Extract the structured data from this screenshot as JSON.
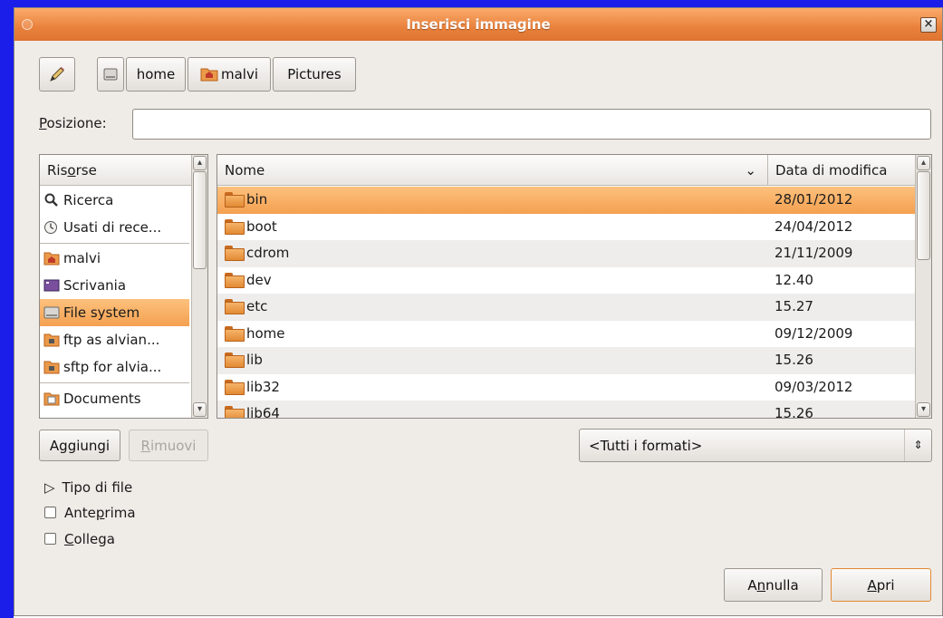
{
  "window": {
    "title": "Inserisci immagine",
    "close_glyph": "×"
  },
  "toolbar": {
    "edit_icon": "pencil-icon",
    "path": [
      {
        "label": "",
        "icon": "harddisk-icon"
      },
      {
        "label": "home",
        "icon": ""
      },
      {
        "label": "malvi",
        "icon": "home-folder-icon"
      },
      {
        "label": "Pictures",
        "icon": ""
      }
    ]
  },
  "location": {
    "label_underline": "P",
    "label_rest": "osizione:",
    "value": ""
  },
  "places": {
    "header_a": "Ris",
    "header_u": "o",
    "header_b": "rse",
    "items": [
      {
        "label": "Ricerca",
        "icon": "search-icon"
      },
      {
        "label": "Usati di rece...",
        "icon": "recent-icon"
      },
      {
        "label": "malvi",
        "icon": "home-folder-icon"
      },
      {
        "label": "Scrivania",
        "icon": "desktop-icon"
      },
      {
        "label": "File system",
        "icon": "harddisk-icon"
      },
      {
        "label": "ftp as alvian...",
        "icon": "network-folder-icon"
      },
      {
        "label": "sftp for alvia...",
        "icon": "network-folder-icon"
      },
      {
        "label": "Documents",
        "icon": "documents-icon"
      }
    ]
  },
  "files": {
    "col_name": "Nome",
    "col_sort_glyph": "⌄",
    "col_date": "Data di modifica",
    "rows": [
      {
        "name": "bin",
        "date": "28/01/2012"
      },
      {
        "name": "boot",
        "date": "24/04/2012"
      },
      {
        "name": "cdrom",
        "date": "21/11/2009"
      },
      {
        "name": "dev",
        "date": "12.40"
      },
      {
        "name": "etc",
        "date": "15.27"
      },
      {
        "name": "home",
        "date": "09/12/2009"
      },
      {
        "name": "lib",
        "date": "15.26"
      },
      {
        "name": "lib32",
        "date": "09/03/2012"
      },
      {
        "name": "lib64",
        "date": "15.26"
      }
    ]
  },
  "buttons": {
    "add": "Aggiungi",
    "remove_u": "R",
    "remove_rest": "imuovi",
    "cancel_a": "A",
    "cancel_u": "n",
    "cancel_b": "nulla",
    "open_u": "A",
    "open_rest": "pri"
  },
  "filter": {
    "selected": "<Tutti i formati>"
  },
  "options": {
    "file_type": "Tipo di file",
    "preview_a": "Ante",
    "preview_u": "p",
    "preview_b": "rima",
    "link_u": "C",
    "link_rest": "ollega"
  },
  "colors": {
    "accent": "#f4a050",
    "frame": "#1a1ee8"
  }
}
